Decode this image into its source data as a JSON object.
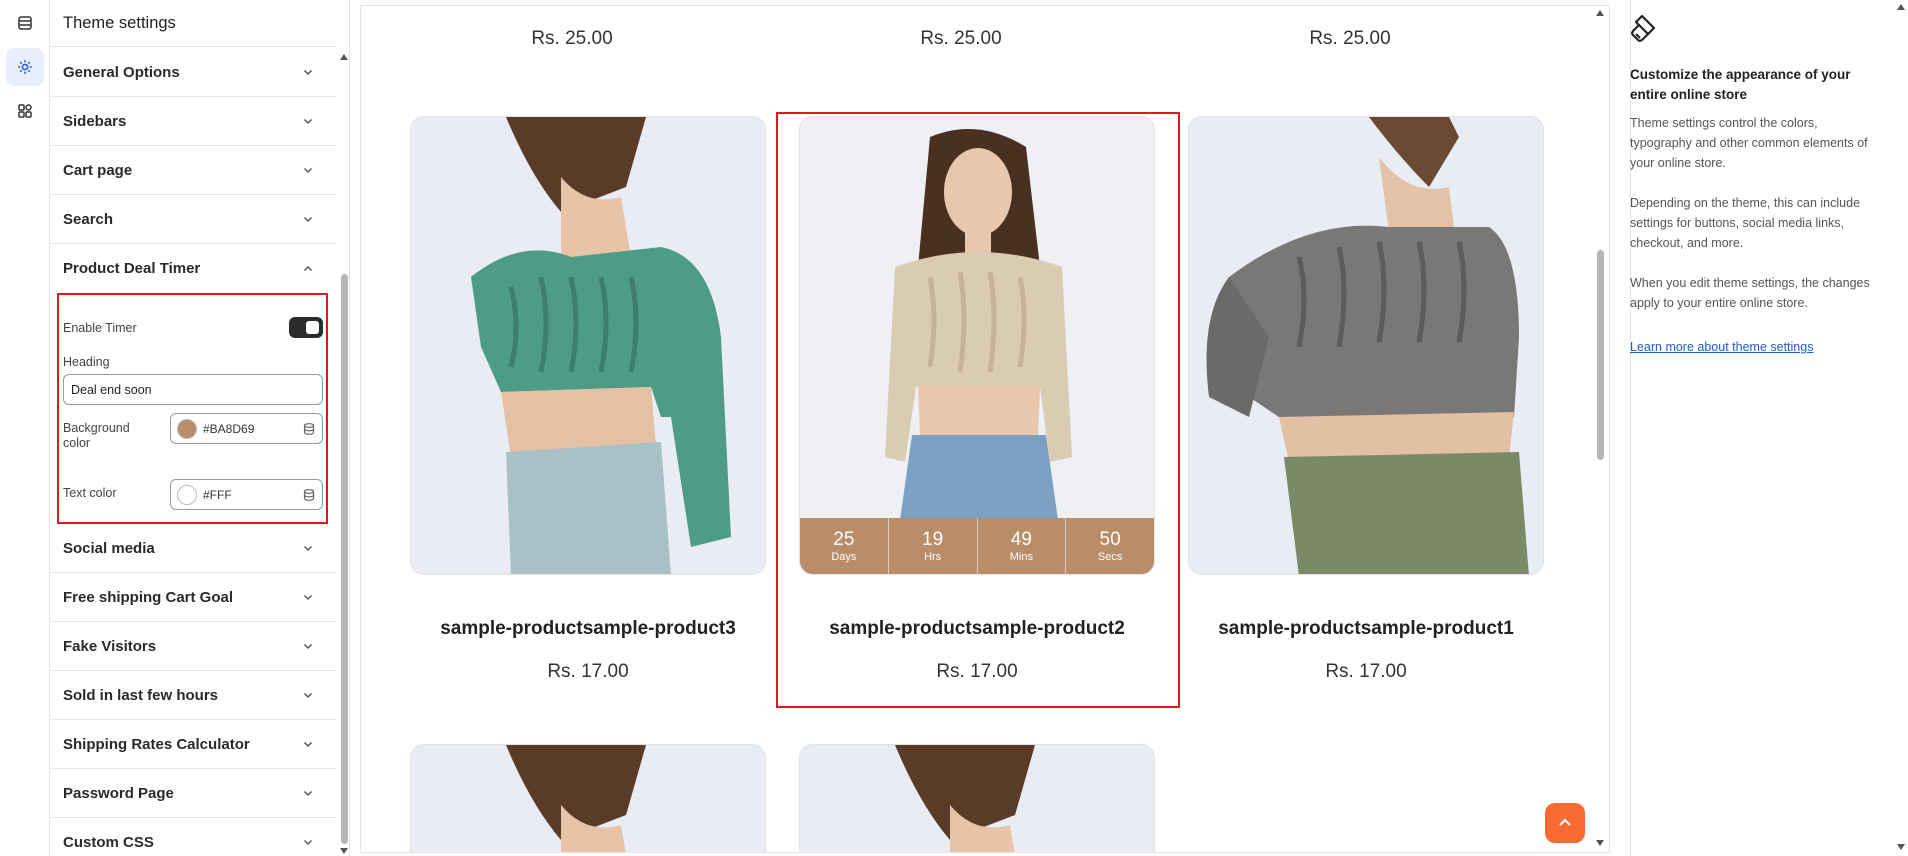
{
  "rail": {
    "icons": [
      "sections-icon",
      "theme-settings-gear-icon",
      "apps-icon"
    ]
  },
  "panel": {
    "title": "Theme settings",
    "sections_before": [
      {
        "label": "General Options"
      },
      {
        "label": "Sidebars"
      },
      {
        "label": "Cart page"
      },
      {
        "label": "Search"
      }
    ],
    "open_section": {
      "label": "Product Deal Timer",
      "enable_timer_label": "Enable Timer",
      "enable_timer_on": true,
      "heading_label": "Heading",
      "heading_value": "Deal end soon",
      "bg_color_label": "Background color",
      "bg_color_value": "#BA8D69",
      "text_color_label": "Text color",
      "text_color_value": "#FFF"
    },
    "sections_after": [
      {
        "label": "Social media"
      },
      {
        "label": "Free shipping Cart Goal"
      },
      {
        "label": "Fake Visitors"
      },
      {
        "label": "Sold in last few hours"
      },
      {
        "label": "Shipping Rates Calculator"
      },
      {
        "label": "Password Page"
      },
      {
        "label": "Custom CSS"
      }
    ]
  },
  "preview": {
    "top_prices": [
      "Rs. 25.00",
      "Rs. 25.00",
      "Rs. 25.00"
    ],
    "products": [
      {
        "title": "sample-productsample-product3",
        "price": "Rs. 17.00",
        "sweater_color": "#4f9c86"
      },
      {
        "title": "sample-productsample-product2",
        "price": "Rs. 17.00",
        "sweater_color": "#d9ccb2"
      },
      {
        "title": "sample-productsample-product1",
        "price": "Rs. 17.00",
        "sweater_color": "#7a7777"
      }
    ],
    "timer": [
      {
        "num": "25",
        "unit": "Days"
      },
      {
        "num": "19",
        "unit": "Hrs"
      },
      {
        "num": "49",
        "unit": "Mins"
      },
      {
        "num": "50",
        "unit": "Secs"
      }
    ],
    "highlight_color": "#d81c1c",
    "scroll_top_color": "#fb6a30"
  },
  "info": {
    "icon": "paint-brush-icon",
    "title": "Customize the appearance of your entire online store",
    "p1": "Theme settings control the colors, typography and other common elements of your online store.",
    "p2": "Depending on the theme, this can include settings for buttons, social media links, checkout, and more.",
    "p3": "When you edit theme settings, the changes apply to your entire online store.",
    "link": "Learn more about theme settings"
  }
}
